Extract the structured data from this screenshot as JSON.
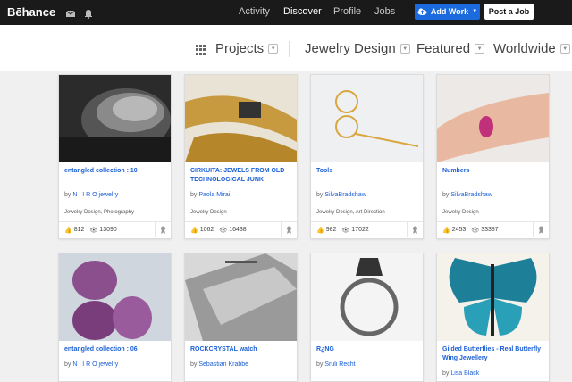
{
  "topbar": {
    "logo": "Bēhance",
    "icons": [
      "mail-icon",
      "bell-icon"
    ],
    "nav": [
      "Activity",
      "Discover",
      "Profile",
      "Jobs"
    ],
    "active_nav": "Discover",
    "add_work_label": "Add Work",
    "post_job_label": "Post a Job"
  },
  "filters": {
    "projects": "Projects",
    "category": "Jewelry Design",
    "sort": "Featured",
    "location": "Worldwide"
  },
  "projects": [
    {
      "title": "entangled collection : 10",
      "by": "by",
      "author": "N I I R O jewelry",
      "fields": "Jewelry Design, Photography",
      "appreciations": "812",
      "views": "13090"
    },
    {
      "title": "CIRKUITA: JEWELS FROM OLD TECHNOLOGICAL JUNK",
      "by": "by",
      "author": "Paola Mirai",
      "fields": "Jewelry Design",
      "appreciations": "1062",
      "views": "16438"
    },
    {
      "title": "Tools",
      "by": "by",
      "author": "SilvaBradshaw",
      "fields": "Jewelry Design, Art Direction",
      "appreciations": "982",
      "views": "17022"
    },
    {
      "title": "Numbers",
      "by": "by",
      "author": "SilvaBradshaw",
      "fields": "Jewelry Design",
      "appreciations": "2453",
      "views": "33387"
    },
    {
      "title": "entangled collection : 06",
      "by": "by",
      "author": "N I I R O jewelry"
    },
    {
      "title": "ROCKCRYSTAL watch",
      "by": "by",
      "author": "Sebastian Krabbe"
    },
    {
      "title": "R¿NG",
      "by": "by",
      "author": "Sruli Recht"
    },
    {
      "title": "Gilded Butterflies - Real Butterfly Wing Jewellery",
      "by": "by",
      "author": "Lisa Black"
    }
  ]
}
